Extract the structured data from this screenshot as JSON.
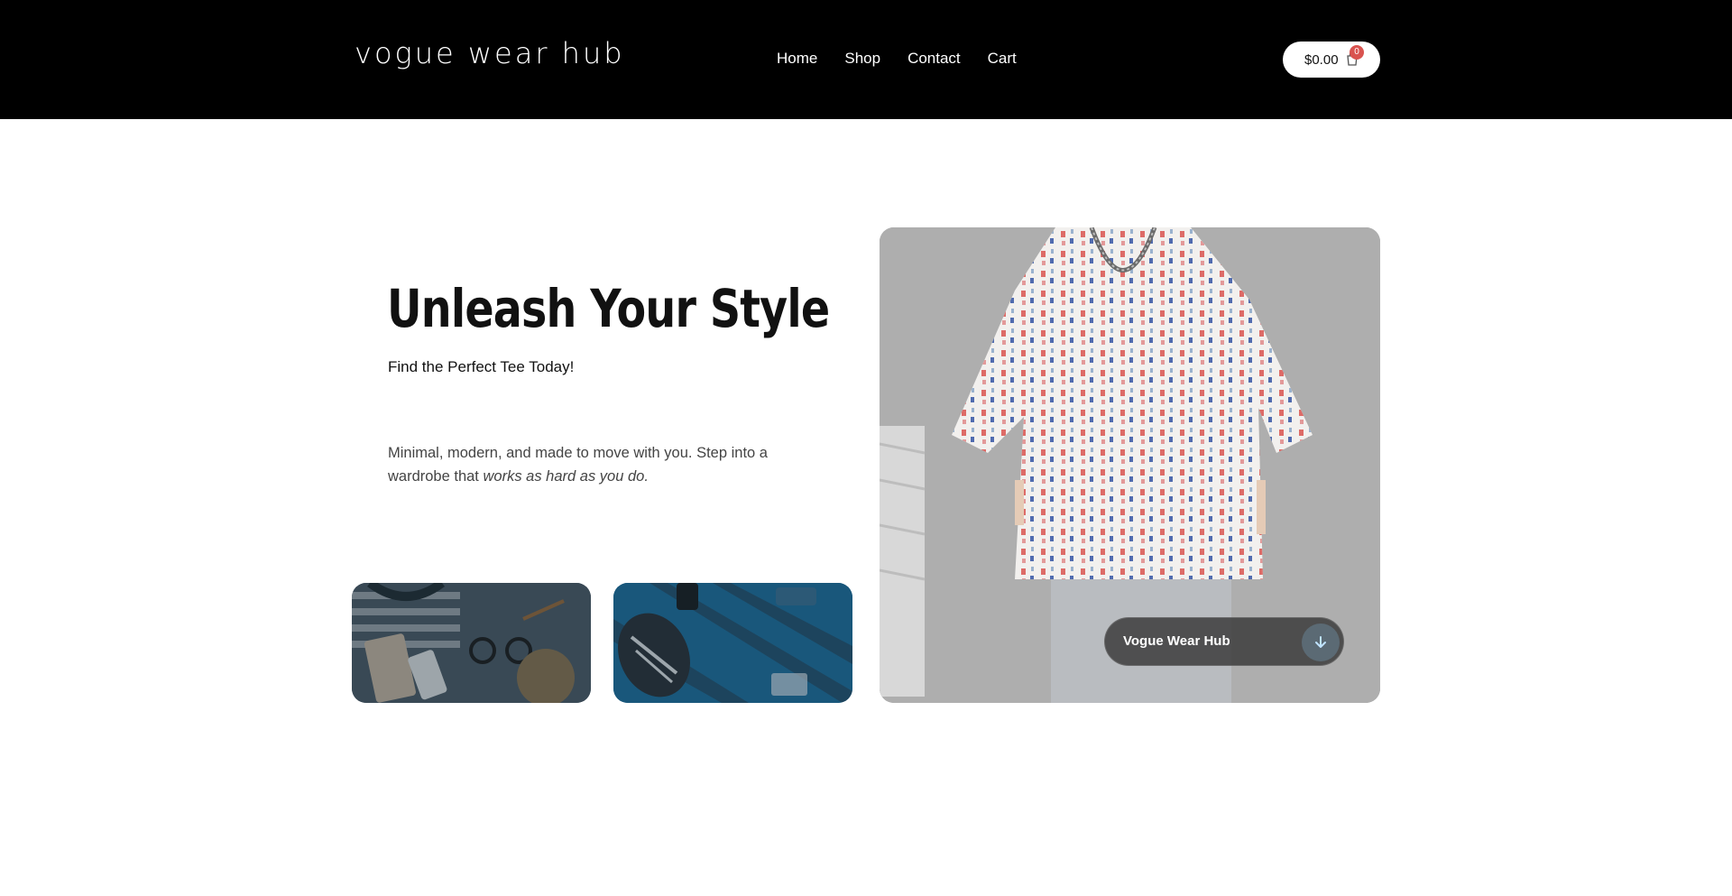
{
  "header": {
    "logo": "vogue wear hub",
    "nav": [
      {
        "label": "Home"
      },
      {
        "label": "Shop"
      },
      {
        "label": "Contact"
      },
      {
        "label": "Cart"
      }
    ],
    "cart": {
      "total": "$0.00",
      "count": "0",
      "icon": "shopping-bag-icon"
    }
  },
  "hero": {
    "title": "Unleash Your Style",
    "subtitle": "Find the Perfect Tee Today!",
    "description_plain": "Minimal, modern, and made to move with you. Step into a wardrobe that ",
    "description_italic": "works as hard as you do."
  },
  "feature": {
    "badge_label": "Vogue Wear Hub",
    "badge_icon": "arrow-down-icon"
  },
  "colors": {
    "header_bg": "#000000",
    "cart_badge": "#d9534f",
    "text_primary": "#111111",
    "text_secondary": "#444444"
  }
}
